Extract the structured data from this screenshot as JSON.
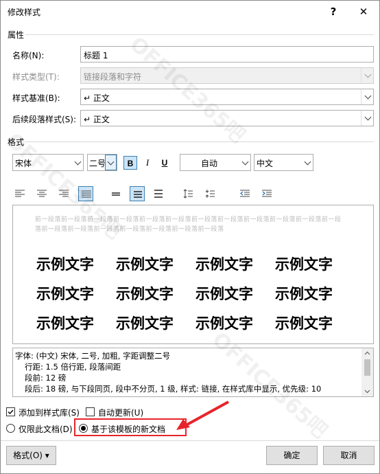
{
  "window": {
    "title": "修改样式",
    "help_label": "?",
    "close_label": "✕"
  },
  "properties": {
    "section_label": "属性",
    "name_label": "名称(N):",
    "name_value": "标题 1",
    "style_type_label": "样式类型(T):",
    "style_type_value": "链接段落和字符",
    "based_on_label": "样式基准(B):",
    "based_on_value": "↵ 正文",
    "following_label": "后续段落样式(S):",
    "following_value": "↵ 正文"
  },
  "formatting": {
    "section_label": "格式",
    "font": "宋体",
    "size": "二号",
    "bold": "B",
    "italic": "I",
    "underline": "U",
    "color": "自动",
    "script": "中文"
  },
  "preview": {
    "previous_paragraph": "前一段落前一段落前一段落前一段落前一段落前一段落前一段落前一段落前一段落前一段落前一段落前一段落前一段落前一段落前一段落前一段落前一段落前一段落前一段落",
    "sample_text": "示例文字"
  },
  "description": {
    "line1": "字体: (中文) 宋体, 二号, 加粗, 字距调整二号",
    "line2": "行距: 1.5 倍行距, 段落间距",
    "line3": "段前: 12 磅",
    "line4": "段后: 18 磅, 与下段同页, 段中不分页, 1 级, 样式: 链接, 在样式库中显示, 优先级: 10"
  },
  "options": {
    "add_to_gallery": "添加到样式库(S)",
    "auto_update": "自动更新(U)",
    "this_document_only": "仅限此文档(D)",
    "new_documents": "基于该模板的新文档"
  },
  "buttons": {
    "format": "格式(O) ▾",
    "ok": "确定",
    "cancel": "取消"
  },
  "watermark": "OFFICE365吧",
  "colors": {
    "accent": "#3c7fb1",
    "highlight_box": "#e8242a",
    "arrow": "#e8242a"
  }
}
